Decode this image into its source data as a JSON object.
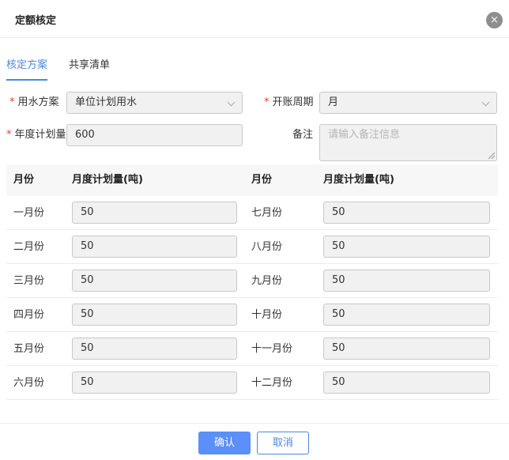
{
  "dialog": {
    "title": "定额核定",
    "close_icon": "×"
  },
  "tabs": [
    {
      "label": "核定方案",
      "active": true
    },
    {
      "label": "共享清单",
      "active": false
    }
  ],
  "form": {
    "water_plan": {
      "required_mark": "*",
      "label": "用水方案",
      "value": "单位计划用水"
    },
    "billing_cycle": {
      "required_mark": "*",
      "label": "开账周期",
      "value": "月"
    },
    "annual_plan": {
      "required_mark": "*",
      "label": "年度计划量",
      "value": "600"
    },
    "remarks": {
      "label": "备注",
      "placeholder": "请输入备注信息"
    }
  },
  "table": {
    "headers": {
      "month": "月份",
      "amount": "月度计划量(吨)"
    },
    "rows": [
      {
        "left_month": "一月份",
        "left_value": "50",
        "right_month": "七月份",
        "right_value": "50"
      },
      {
        "left_month": "二月份",
        "left_value": "50",
        "right_month": "八月份",
        "right_value": "50"
      },
      {
        "left_month": "三月份",
        "left_value": "50",
        "right_month": "九月份",
        "right_value": "50"
      },
      {
        "left_month": "四月份",
        "left_value": "50",
        "right_month": "十月份",
        "right_value": "50"
      },
      {
        "left_month": "五月份",
        "left_value": "50",
        "right_month": "十一月份",
        "right_value": "50"
      },
      {
        "left_month": "六月份",
        "left_value": "50",
        "right_month": "十二月份",
        "right_value": "50"
      }
    ]
  },
  "footer": {
    "confirm_label": "确认",
    "cancel_label": "取消"
  },
  "colors": {
    "accent": "#4a86e8",
    "primary_button": "#5b8ff9",
    "required": "#e2402e"
  }
}
